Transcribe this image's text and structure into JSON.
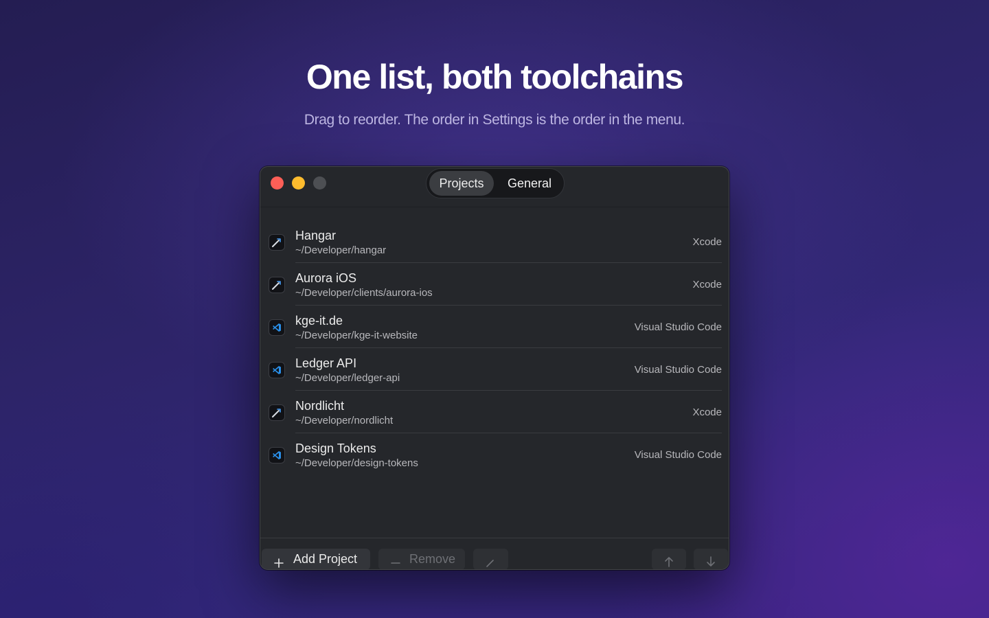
{
  "hero": {
    "title": "One list, both toolchains",
    "subtitle": "Drag to reorder. The order in Settings is the order in the menu."
  },
  "window": {
    "tabs": [
      {
        "label": "Projects",
        "selected": true
      },
      {
        "label": "General",
        "selected": false
      }
    ],
    "projects": [
      {
        "name": "Hangar",
        "path": "~/Developer/hangar",
        "tool": "Xcode",
        "icon": "xcode-icon"
      },
      {
        "name": "Aurora iOS",
        "path": "~/Developer/clients/aurora-ios",
        "tool": "Xcode",
        "icon": "xcode-icon"
      },
      {
        "name": "kge-it.de",
        "path": "~/Developer/kge-it-website",
        "tool": "Visual Studio Code",
        "icon": "vscode-icon"
      },
      {
        "name": "Ledger API",
        "path": "~/Developer/ledger-api",
        "tool": "Visual Studio Code",
        "icon": "vscode-icon"
      },
      {
        "name": "Nordlicht",
        "path": "~/Developer/nordlicht",
        "tool": "Xcode",
        "icon": "xcode-icon"
      },
      {
        "name": "Design Tokens",
        "path": "~/Developer/design-tokens",
        "tool": "Visual Studio Code",
        "icon": "vscode-icon"
      }
    ],
    "toolbar": {
      "add_label": "Add Project",
      "remove_label": "Remove",
      "add_icon": "plus-icon",
      "remove_icon": "minus-icon",
      "edit_icon": "pencil-icon",
      "move_up_icon": "arrow-up-icon",
      "move_down_icon": "arrow-down-icon"
    }
  },
  "colors": {
    "close": "#fe5f57",
    "minimize": "#febc2e",
    "zoom": "#4d4f53",
    "window_bg": "#25272b",
    "vscode_blue": "#2a8fe8"
  }
}
